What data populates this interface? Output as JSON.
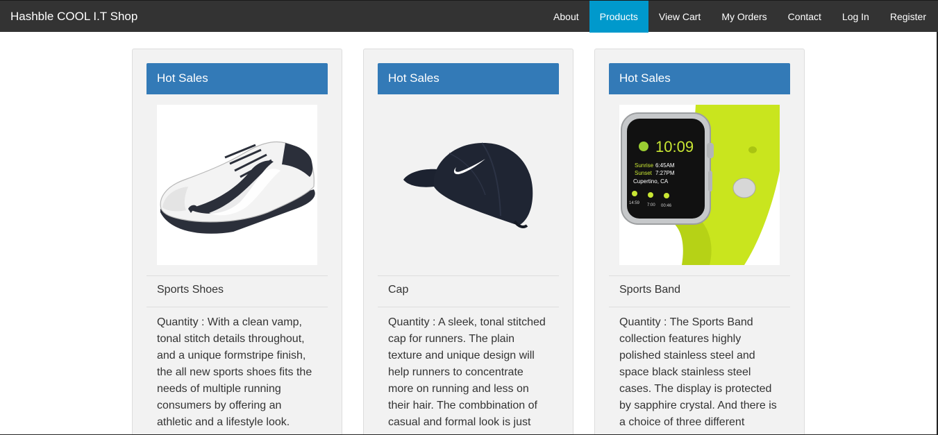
{
  "navbar": {
    "brand": "Hashble COOL I.T Shop",
    "items": [
      {
        "label": "About"
      },
      {
        "label": "Products"
      },
      {
        "label": "View Cart"
      },
      {
        "label": "My Orders"
      },
      {
        "label": "Contact"
      },
      {
        "label": "Log In"
      },
      {
        "label": "Register"
      }
    ],
    "active_item": "Products",
    "colors": {
      "bar": "#333333",
      "active": "#0099cc"
    }
  },
  "products": [
    {
      "heading": "Hot Sales",
      "image": "sports-shoe-image",
      "name": "Sports Shoes",
      "description": "Quantity : With a clean vamp, tonal stitch details throughout, and a unique formstripe finish, the all new sports shoes fits the needs of multiple running consumers by offering an athletic and a lifestyle look."
    },
    {
      "heading": "Hot Sales",
      "image": "cap-image",
      "name": "Cap",
      "description": "Quantity : A sleek, tonal stitched cap for runners. The plain texture and unique design will help runners to concentrate more on running and less on their hair. The combbination of casual and formal look is just"
    },
    {
      "heading": "Hot Sales",
      "image": "smart-watch-image",
      "name": "Sports Band",
      "description": "Quantity : The Sports Band collection features highly polished stainless steel and space black stainless steel cases. The display is protected by sapphire crystal. And there is a choice of three different"
    }
  ],
  "watch_face": {
    "time": "10:09",
    "sunrise_label": "Sunrise",
    "sunrise_time": "6:45AM",
    "sunset_label": "Sunset",
    "sunset_time": "7:27PM",
    "city": "Cupertino, CA",
    "timers": [
      "14:59",
      "7:00",
      "00:46"
    ]
  },
  "accent_color": "#337ab7"
}
